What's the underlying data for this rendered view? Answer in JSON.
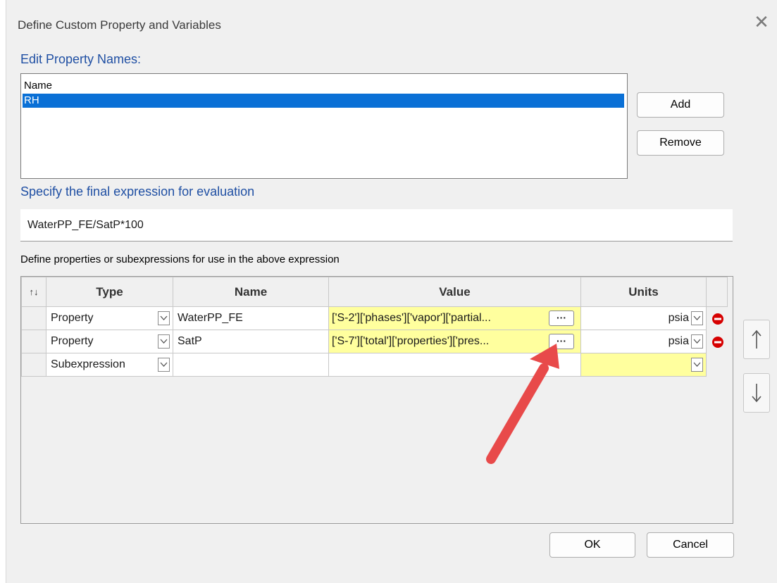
{
  "window": {
    "title": "Define Custom Property and Variables",
    "close_glyph": "✕"
  },
  "property_names": {
    "section_label": "Edit Property Names:",
    "list_header": "Name",
    "items": [
      "RH"
    ],
    "selected_index": 0,
    "add_label": "Add",
    "remove_label": "Remove"
  },
  "final_expression": {
    "section_label": "Specify the final expression for evaluation",
    "value": "WaterPP_FE/SatP*100"
  },
  "definitions": {
    "label": "Define properties or subexpressions for use in the above expression",
    "sort_glyph": "↑↓",
    "columns": [
      "Type",
      "Name",
      "Value",
      "Units"
    ],
    "rows": [
      {
        "type": "Property",
        "name": "WaterPP_FE",
        "value": "['S-2']['phases']['vapor']['partial...",
        "units": "psia"
      },
      {
        "type": "Property",
        "name": "SatP",
        "value": "['S-7']['total']['properties']['pres...",
        "units": "psia"
      },
      {
        "type": "Subexpression",
        "name": "",
        "value": "",
        "units": ""
      }
    ],
    "ellipsis_label": "···"
  },
  "footer": {
    "ok_label": "OK",
    "cancel_label": "Cancel"
  },
  "colors": {
    "accent": "#1f4fa3",
    "selection": "#0a70d6",
    "value_highlight": "#ffff9e",
    "arrow": "#e84a4a",
    "delete_icon": "#d60000"
  },
  "icons": [
    "close-icon",
    "chevron-down-icon",
    "ellipsis-icon",
    "delete-row-icon",
    "move-up-icon",
    "move-down-icon",
    "annotation-arrow"
  ]
}
